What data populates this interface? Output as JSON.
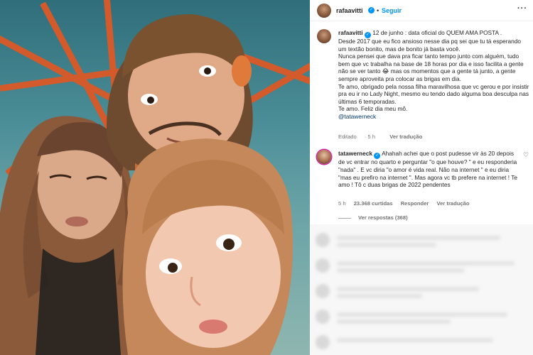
{
  "post": {
    "username": "rafaavitti",
    "separator": "•",
    "follow_label": "Seguir",
    "more_icon": "more-horizontal-icon",
    "verified_icon": "verified-badge-icon"
  },
  "caption": {
    "username": "rafaavitti",
    "lines": [
      "12 de junho : data oficial do QUEM AMA POSTA .",
      "Desde 2017 que eu fico ansioso nesse dia pq sei que tu tá esperando um textão bonito, mas de bonito já basta você.",
      "Nunca pensei que dava pra ficar tanto tempo junto com alguém, tudo bem que vc trabalha na base de 18 horas por dia e isso facilita a gente não se ver tanto 😂 mas os momentos que a gente tá junto, a gente sempre aproveita pra colocar as brigas em dia.",
      "Te amo, obrigado pela nossa filha maravilhosa que vc gerou e por insistir pra eu ir no Lady Night, mesmo eu tendo dado alguma boa desculpa nas últimas 6 temporadas.",
      "Te amo. Feliz dia meu mô."
    ],
    "mention": "@tatawerneck",
    "edited_label": "Editado",
    "time": "5 h",
    "translate_label": "Ver tradução"
  },
  "comment": {
    "username": "tatawerneck",
    "text": "Ahahah achei que o post pudesse vir às 20 depois de vc entrar no quarto e perguntar \"o que houve? \" e eu responderia \"nada\" . E vc diria \"o amor é vida real. Não na internet \" e eu diria \"mas eu prefiro na internet \". Mas agora vc tb prefere na internet ! Te amo ! Tô c duas brigas de 2022 pendentes",
    "time": "5 h",
    "likes": "23.368 curtidas",
    "reply_label": "Responder",
    "translate_label": "Ver tradução",
    "like_icon": "heart-outline-icon",
    "view_replies": "Ver respostas (368)"
  },
  "colors": {
    "link_blue": "#0095f6",
    "mention_blue": "#00376b",
    "muted_text": "#737373",
    "text": "#262626",
    "verified": "#0095f6"
  }
}
